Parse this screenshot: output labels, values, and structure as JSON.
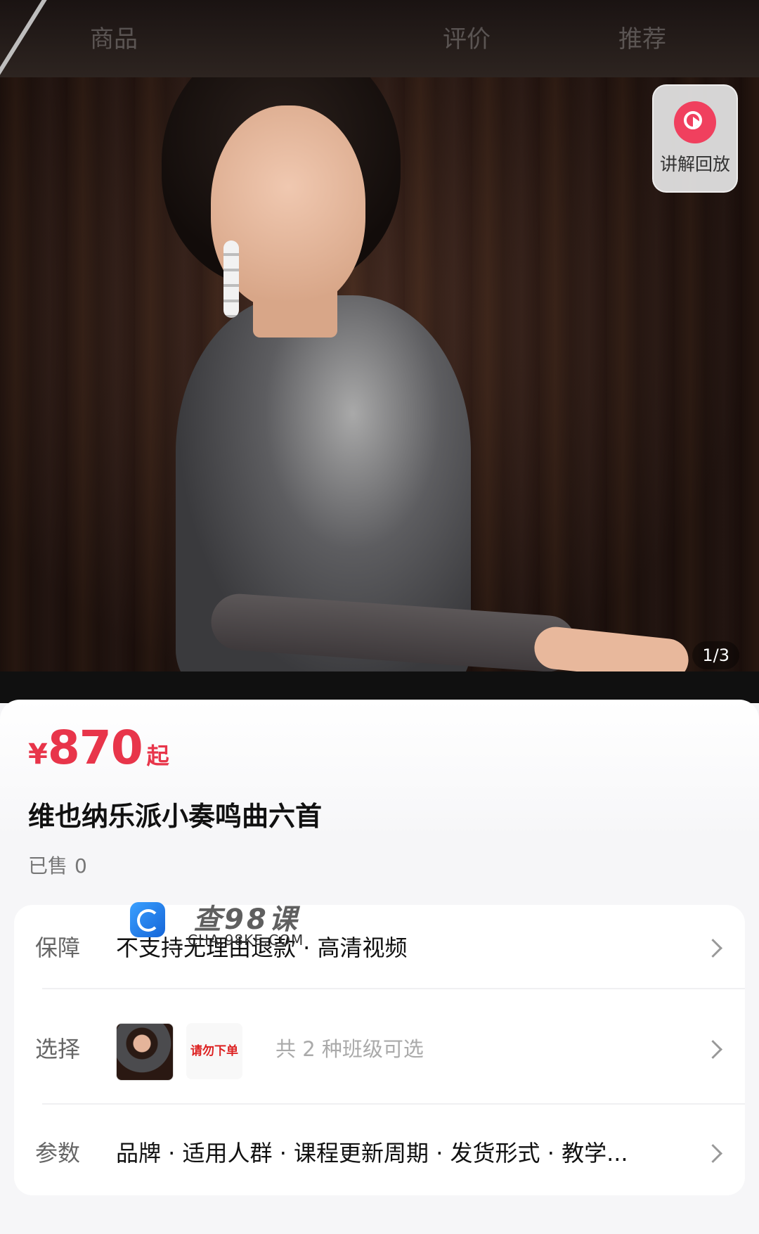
{
  "header": {
    "tabs": [
      "商品",
      "评价",
      "推荐"
    ]
  },
  "media": {
    "replay_label": "讲解回放",
    "counter": "1/3"
  },
  "product": {
    "price_symbol": "¥",
    "price": "870",
    "price_suffix": "起",
    "title": "维也纳乐派小奏鸣曲六首",
    "sold_label": "已售",
    "sold_count": "0"
  },
  "details": {
    "guarantee_label": "保障",
    "guarantee_text": "不支持无理由退款 · 高清视频",
    "choose_label": "选择",
    "choose_tag": "请勿下单",
    "choose_summary": "共 2 种班级可选",
    "params_label": "参数",
    "params_text": "品牌 · 适用人群 · 课程更新周期 · 发货形式 · 教学..."
  },
  "watermark": {
    "title": "查98课",
    "subtitle": "CHA.98KE.COM"
  },
  "colors": {
    "accent": "#e8354a",
    "replay_icon": "#f0405e"
  }
}
